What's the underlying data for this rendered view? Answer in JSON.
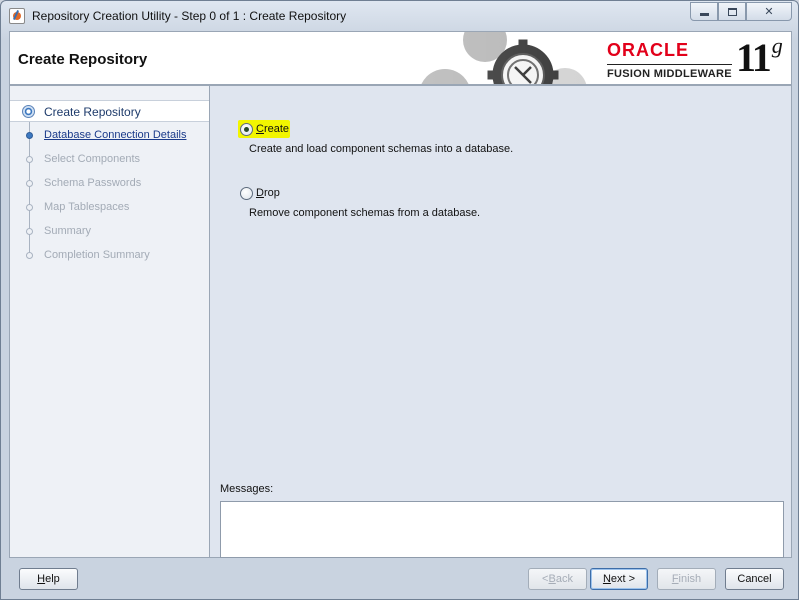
{
  "window": {
    "title": "Repository Creation Utility - Step 0 of 1 : Create Repository",
    "app_icon": "java-cup-icon"
  },
  "header": {
    "page_title": "Create Repository",
    "brand": "ORACLE",
    "brand_sub": "FUSION MIDDLEWARE",
    "version_main": "11",
    "version_suffix": "g",
    "brand_color": "#e2001a"
  },
  "nav": {
    "steps": [
      {
        "label": "Create Repository",
        "state": "current"
      },
      {
        "label": "Database Connection Details",
        "state": "next"
      },
      {
        "label": "Select Components",
        "state": "disabled"
      },
      {
        "label": "Schema Passwords",
        "state": "disabled"
      },
      {
        "label": "Map Tablespaces",
        "state": "disabled"
      },
      {
        "label": "Summary",
        "state": "disabled"
      },
      {
        "label": "Completion Summary",
        "state": "disabled"
      }
    ]
  },
  "main": {
    "options": [
      {
        "mnemonic": "C",
        "label_rest": "reate",
        "description": "Create and load component schemas into a database.",
        "selected": true
      },
      {
        "mnemonic": "D",
        "label_rest": "rop",
        "description": "Remove component schemas from a database.",
        "selected": false
      }
    ],
    "messages_label": "Messages:",
    "messages_value": ""
  },
  "footer": {
    "help": {
      "mnemonic": "H",
      "rest": "elp"
    },
    "back": {
      "prefix": "< ",
      "mnemonic": "B",
      "rest": "ack"
    },
    "next": {
      "mnemonic": "N",
      "rest": "ext >"
    },
    "finish": {
      "mnemonic": "F",
      "rest": "inish"
    },
    "cancel": "Cancel"
  }
}
